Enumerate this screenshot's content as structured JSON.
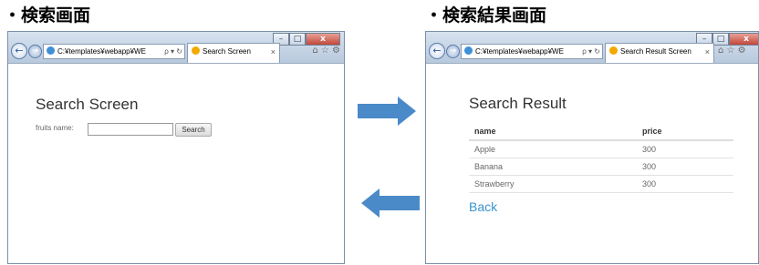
{
  "captions": {
    "search": "・検索画面",
    "result": "・検索結果画面"
  },
  "window_controls": {
    "minimize": "–",
    "maximize": "□",
    "close": "x"
  },
  "search_window": {
    "address": "C:¥templates¥webapp¥WE",
    "address_icons": "ρ ▾ ↻",
    "tab_title": "Search Screen",
    "tab_close": "×",
    "page": {
      "title": "Search Screen",
      "field_label": "fruits name:",
      "input_value": "",
      "search_button": "Search"
    }
  },
  "result_window": {
    "address": "C:¥templates¥webapp¥WE",
    "address_icons": "ρ ▾ ↻",
    "tab_title": "Search Result Screen",
    "tab_close": "×",
    "toolbar_icons": "⌂ ☆ ⚙",
    "page": {
      "title": "Search Result",
      "table": {
        "headers": [
          "name",
          "price"
        ],
        "rows": [
          [
            "Apple",
            "300"
          ],
          [
            "Banana",
            "300"
          ],
          [
            "Strawberry",
            "300"
          ]
        ]
      },
      "back_link": "Back"
    }
  },
  "search_toolbar_icons": "⌂ ☆ ⚙",
  "colors": {
    "arrow": "#4a8ac9",
    "link": "#3a93cf",
    "close_button": "#c2483a"
  }
}
